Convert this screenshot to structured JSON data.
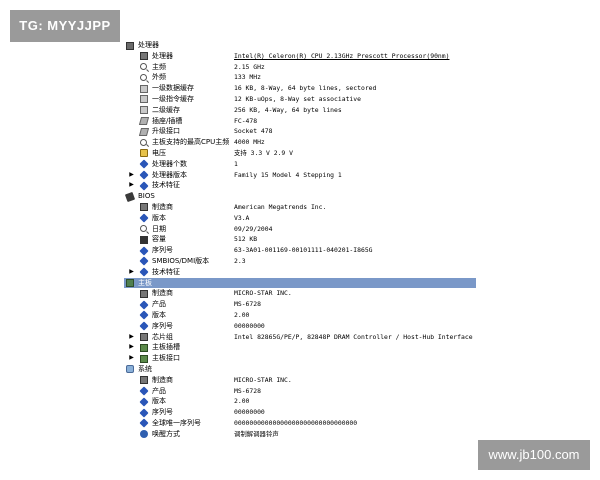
{
  "watermarks": {
    "top_left": "TG: MYYJJPP",
    "bottom_right": "www.jb100.com"
  },
  "colors": {
    "selection": "#7a98c8",
    "watermark_bg": "#9a9a9a",
    "icon_blue": "#2a56b8"
  },
  "rows": [
    {
      "level": 0,
      "expander": "",
      "icon": "cpu-category-icon",
      "cls": "cat-cpu",
      "label": "处理器",
      "value": ""
    },
    {
      "level": 1,
      "expander": "",
      "icon": "processor-chip-icon",
      "cls": "chip",
      "label": "处理器",
      "value": "Intel(R) Celeron(R) CPU 2.13GHz Prescott Processor(90nm)",
      "underline": true
    },
    {
      "level": 1,
      "expander": "",
      "icon": "magnifier-icon",
      "cls": "mag",
      "label": "主频",
      "value": "2.15 GHz"
    },
    {
      "level": 1,
      "expander": "",
      "icon": "magnifier-icon",
      "cls": "mag",
      "label": "外频",
      "value": "133 MHz"
    },
    {
      "level": 1,
      "expander": "",
      "icon": "cache-icon",
      "cls": "cache",
      "label": "一级数据缓存",
      "value": "16 KB, 8-Way, 64 byte lines, sectored"
    },
    {
      "level": 1,
      "expander": "",
      "icon": "cache-icon",
      "cls": "cache",
      "label": "一级指令缓存",
      "value": "12 KB-uOps, 8-Way set associative"
    },
    {
      "level": 1,
      "expander": "",
      "icon": "cache-icon",
      "cls": "cache",
      "label": "二级缓存",
      "value": "256 KB, 4-Way, 64 byte lines"
    },
    {
      "level": 1,
      "expander": "",
      "icon": "socket-icon",
      "cls": "socket",
      "label": "插座/插槽",
      "value": "FC-478"
    },
    {
      "level": 1,
      "expander": "",
      "icon": "socket-icon",
      "cls": "socket",
      "label": "升级接口",
      "value": "Socket 478"
    },
    {
      "level": 1,
      "expander": "",
      "icon": "magnifier-icon",
      "cls": "mag",
      "label": "主板支持的最高CPU主频",
      "value": "4000 MHz"
    },
    {
      "level": 1,
      "expander": "",
      "icon": "voltage-icon",
      "cls": "volt",
      "label": "电压",
      "value": "支持 3.3 V 2.9 V"
    },
    {
      "level": 1,
      "expander": "",
      "icon": "info-diamond-icon",
      "cls": "diamond",
      "label": "处理器个数",
      "value": "1"
    },
    {
      "level": 1,
      "expander": "▶",
      "icon": "info-diamond-icon",
      "cls": "diamond",
      "label": "处理器版本",
      "value": "Family 15 Model 4 Stepping 1"
    },
    {
      "level": 1,
      "expander": "▶",
      "icon": "info-diamond-icon",
      "cls": "diamond",
      "label": "技术特征",
      "value": ""
    },
    {
      "level": 0,
      "expander": "",
      "icon": "bios-category-icon",
      "cls": "cat-bios",
      "label": "BIOS",
      "value": ""
    },
    {
      "level": 1,
      "expander": "",
      "icon": "manufacturer-icon",
      "cls": "chip",
      "label": "制造商",
      "value": "American Megatrends Inc."
    },
    {
      "level": 1,
      "expander": "",
      "icon": "info-diamond-icon",
      "cls": "diamond",
      "label": "版本",
      "value": "V3.A"
    },
    {
      "level": 1,
      "expander": "",
      "icon": "magnifier-icon",
      "cls": "mag",
      "label": "日期",
      "value": "09/29/2004"
    },
    {
      "level": 1,
      "expander": "",
      "icon": "memory-icon",
      "cls": "mem",
      "label": "容量",
      "value": "512 KB"
    },
    {
      "level": 1,
      "expander": "",
      "icon": "info-diamond-icon",
      "cls": "diamond",
      "label": "序列号",
      "value": "63-3A01-001169-00101111-040201-I865G"
    },
    {
      "level": 1,
      "expander": "",
      "icon": "info-diamond-icon",
      "cls": "diamond",
      "label": "SMBIOS/DMI版本",
      "value": "2.3"
    },
    {
      "level": 1,
      "expander": "▶",
      "icon": "info-diamond-icon",
      "cls": "diamond",
      "label": "技术特征",
      "value": ""
    },
    {
      "level": 0,
      "expander": "",
      "icon": "motherboard-category-icon",
      "cls": "cat-board",
      "label": "主板",
      "value": "",
      "selected": true
    },
    {
      "level": 1,
      "expander": "",
      "icon": "manufacturer-icon",
      "cls": "chip",
      "label": "制造商",
      "value": "MICRO-STAR INC."
    },
    {
      "level": 1,
      "expander": "",
      "icon": "info-diamond-icon",
      "cls": "diamond",
      "label": "产品",
      "value": "MS-6728"
    },
    {
      "level": 1,
      "expander": "",
      "icon": "info-diamond-icon",
      "cls": "diamond",
      "label": "版本",
      "value": "2.00"
    },
    {
      "level": 1,
      "expander": "",
      "icon": "info-diamond-icon",
      "cls": "diamond",
      "label": "序列号",
      "value": "00000000"
    },
    {
      "level": 1,
      "expander": "▶",
      "icon": "chipset-icon",
      "cls": "chip",
      "label": "芯片组",
      "value": "Intel 82865G/PE/P, 82848P DRAM Controller / Host-Hub Interface"
    },
    {
      "level": 1,
      "expander": "▶",
      "icon": "slot-icon",
      "cls": "slot",
      "label": "主板插槽",
      "value": ""
    },
    {
      "level": 1,
      "expander": "▶",
      "icon": "port-icon",
      "cls": "slot",
      "label": "主板接口",
      "value": ""
    },
    {
      "level": 0,
      "expander": "",
      "icon": "system-category-icon",
      "cls": "cat-system",
      "label": "系统",
      "value": ""
    },
    {
      "level": 1,
      "expander": "",
      "icon": "manufacturer-icon",
      "cls": "chip",
      "label": "制造商",
      "value": "MICRO-STAR INC."
    },
    {
      "level": 1,
      "expander": "",
      "icon": "info-diamond-icon",
      "cls": "diamond",
      "label": "产品",
      "value": "MS-6728"
    },
    {
      "level": 1,
      "expander": "",
      "icon": "info-diamond-icon",
      "cls": "diamond",
      "label": "版本",
      "value": "2.00"
    },
    {
      "level": 1,
      "expander": "",
      "icon": "info-diamond-icon",
      "cls": "diamond",
      "label": "序列号",
      "value": "00000000"
    },
    {
      "level": 1,
      "expander": "",
      "icon": "info-diamond-icon",
      "cls": "diamond",
      "label": "全球唯一序列号",
      "value": "00000000000000000000000000000000"
    },
    {
      "level": 1,
      "expander": "",
      "icon": "wake-icon",
      "cls": "sys",
      "label": "唤醒方式",
      "value": "调制解调器铃声"
    }
  ]
}
